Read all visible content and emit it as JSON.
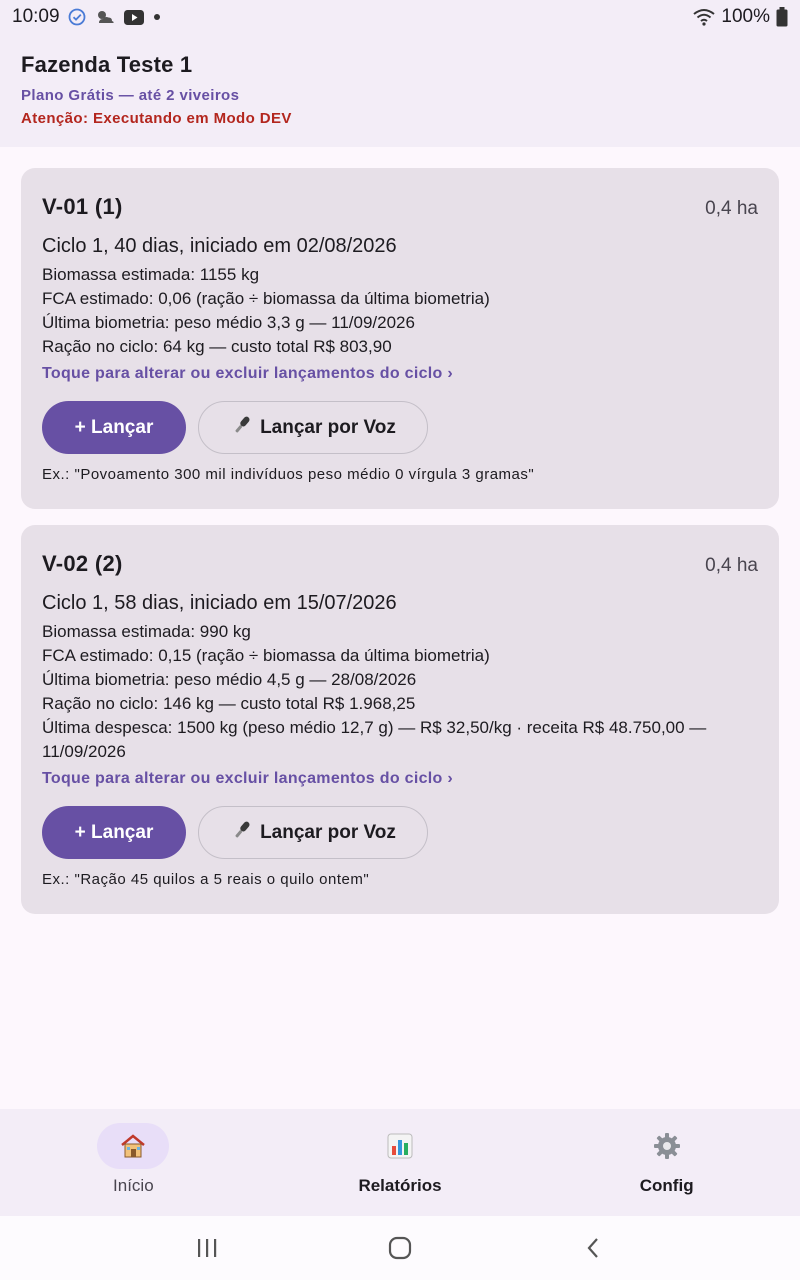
{
  "status_bar": {
    "time": "10:09",
    "battery": "100%",
    "icons": [
      "check-circle-icon",
      "weather-icon",
      "youtube-icon",
      "dot-icon",
      "wifi-icon",
      "battery-icon"
    ]
  },
  "header": {
    "farm_name": "Fazenda Teste 1",
    "plan": "Plano Grátis — até 2 viveiros",
    "dev_warning": "Atenção: Executando em Modo DEV"
  },
  "colors": {
    "primary": "#6750a4",
    "warning": "#b3261e",
    "card_bg": "#e7e0e8"
  },
  "cards": [
    {
      "title": "V-01 (1)",
      "area": "0,4 ha",
      "cycle": "Ciclo 1, 40 dias, iniciado em 02/08/2026",
      "lines": [
        "Biomassa estimada: 1155 kg",
        "FCA estimado: 0,06 (ração ÷ biomassa da última biometria)",
        "Última biometria: peso médio 3,3 g — 11/09/2026",
        "Ração no ciclo: 64 kg — custo total R$ 803,90"
      ],
      "edit_link": "Toque para alterar ou excluir lançamentos do ciclo ›",
      "launch_label": "+ Lançar",
      "voice_label": "Lançar por Voz",
      "example": "Ex.: \"Povoamento 300 mil indivíduos peso médio 0 vírgula 3 gramas\""
    },
    {
      "title": "V-02 (2)",
      "area": "0,4 ha",
      "cycle": "Ciclo 1, 58 dias, iniciado em 15/07/2026",
      "lines": [
        "Biomassa estimada: 990 kg",
        "FCA estimado: 0,15 (ração ÷ biomassa da última biometria)",
        "Última biometria: peso médio 4,5 g — 28/08/2026",
        "Ração no ciclo: 146 kg — custo total R$ 1.968,25",
        "Última despesca: 1500 kg (peso médio 12,7 g) — R$ 32,50/kg · receita R$ 48.750,00 —",
        "11/09/2026"
      ],
      "edit_link": "Toque para alterar ou excluir lançamentos do ciclo ›",
      "launch_label": "+ Lançar",
      "voice_label": "Lançar por Voz",
      "example": "Ex.: \"Ração 45 quilos a 5 reais o quilo ontem\""
    }
  ],
  "bottom_nav": {
    "items": [
      {
        "label": "Início",
        "icon": "house-icon",
        "active": true
      },
      {
        "label": "Relatórios",
        "icon": "bar-chart-icon",
        "active": false
      },
      {
        "label": "Config",
        "icon": "gear-icon",
        "active": false
      }
    ]
  },
  "system_nav": [
    "recents-icon",
    "home-icon",
    "back-icon"
  ]
}
